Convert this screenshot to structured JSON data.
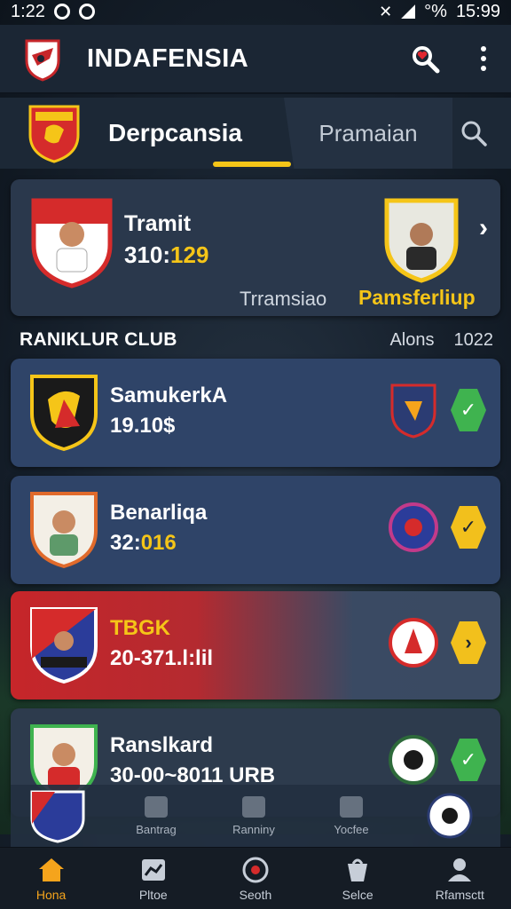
{
  "status_bar": {
    "time": "1:22",
    "battery": "°%",
    "clock": "15:99"
  },
  "app_bar": {
    "title": "INDAFENSIA"
  },
  "tabs": {
    "active": "Derpcansia",
    "other": "Pramaian"
  },
  "match_card": {
    "name": "Tramit",
    "score_prefix": "310:",
    "score_highlight": "129",
    "label_left": "Trramsiao",
    "label_right": "Pamsferliup"
  },
  "section": {
    "title": "RANIKLUR CLUB",
    "right_a": "Alons",
    "right_b": "1022"
  },
  "rows": [
    {
      "name": "SamukerkA",
      "value": "19.10$",
      "value_hl": "",
      "status": "check",
      "status_color": "#3fb34f"
    },
    {
      "name": "Benarliqa",
      "value": "32:",
      "value_hl": "016",
      "status": "check",
      "status_color": "#f2c01c"
    },
    {
      "name": "TBGK",
      "value": "20-371.l:lil",
      "value_hl": "",
      "status": "chevron",
      "status_color": "#f2c01c"
    },
    {
      "name": "Ranslkard",
      "value": "30-00~8011 URB",
      "value_hl": "",
      "status": "check",
      "status_color": "#3fb34f"
    }
  ],
  "mini_nav": [
    "Bantrag",
    "Ranniny",
    "Yocfee"
  ],
  "bottom_nav": [
    {
      "label": "Hona",
      "icon": "home-icon",
      "active": true
    },
    {
      "label": "Pltoe",
      "icon": "chart-icon",
      "active": false
    },
    {
      "label": "Seoth",
      "icon": "target-icon",
      "active": false
    },
    {
      "label": "Selce",
      "icon": "shop-icon",
      "active": false
    },
    {
      "label": "Rfamsctt",
      "icon": "profile-icon",
      "active": false
    }
  ],
  "colors": {
    "accent": "#f5c518",
    "green": "#3fb34f",
    "red": "#c6262a",
    "bg": "#16202c"
  }
}
